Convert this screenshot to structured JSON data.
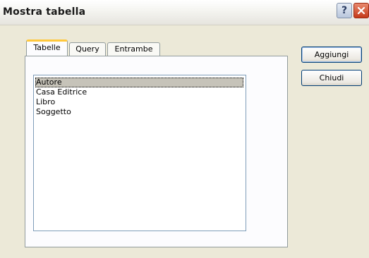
{
  "window": {
    "title": "Mostra tabella",
    "help_label": "?"
  },
  "tabs": [
    {
      "label": "Tabelle",
      "selected": true
    },
    {
      "label": "Query",
      "selected": false
    },
    {
      "label": "Entrambe",
      "selected": false
    }
  ],
  "list": {
    "items": [
      "Autore",
      "Casa Editrice",
      "Libro",
      "Soggetto"
    ],
    "selected_item": "Autore"
  },
  "buttons": {
    "add_label": "Aggiungi",
    "close_label": "Chiudi"
  },
  "icons": {
    "help": "help-icon",
    "close": "close-icon"
  },
  "colors": {
    "selected_tab_accent": "#ffc83c",
    "close_button": "#c4391a",
    "selection": "#c6c3b9"
  }
}
